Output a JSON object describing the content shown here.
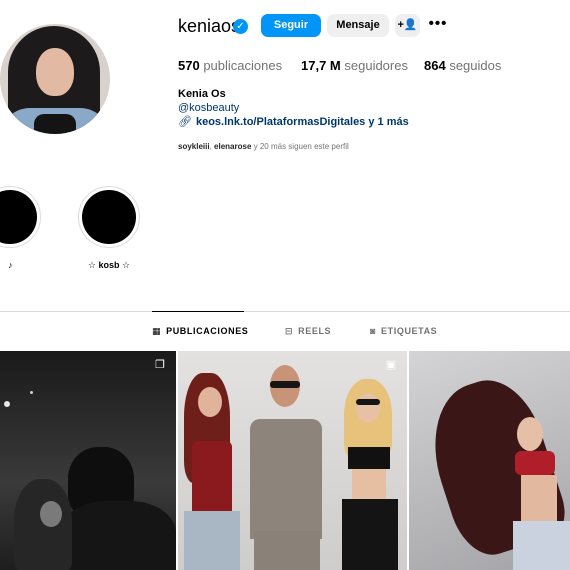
{
  "profile": {
    "username": "keniaos",
    "follow_label": "Seguir",
    "message_label": "Mensaje",
    "more_label": "•••",
    "stats": {
      "posts_count": "570",
      "posts_label": "publicaciones",
      "followers_count": "17,7 M",
      "followers_label": "seguidores",
      "following_count": "864",
      "following_label": "seguidos"
    },
    "name": "Kenia Os",
    "mention": "@kosbeauty",
    "link": "keos.lnk.to/PlataformasDigitales y 1 más",
    "followed_by_1": "soykleiii",
    "followed_by_sep": ", ",
    "followed_by_2": "elenarose",
    "followed_by_rest": " y 20 más siguen este perfil"
  },
  "highlights": [
    {
      "label": "♪"
    },
    {
      "label": "☆ kosb ☆"
    }
  ],
  "tabs": [
    {
      "label": "PUBLICACIONES",
      "icon": "grid-icon",
      "active": true
    },
    {
      "label": "REELS",
      "icon": "reels-icon",
      "active": false
    },
    {
      "label": "ETIQUETAS",
      "icon": "tagged-icon",
      "active": false
    }
  ],
  "posts": [
    {
      "badge": "carousel-icon"
    },
    {
      "badge": "reels-icon"
    },
    {
      "badge": ""
    }
  ],
  "colors": {
    "accent": "#0095f6",
    "link": "#00376b",
    "secondary_text": "#737373"
  }
}
